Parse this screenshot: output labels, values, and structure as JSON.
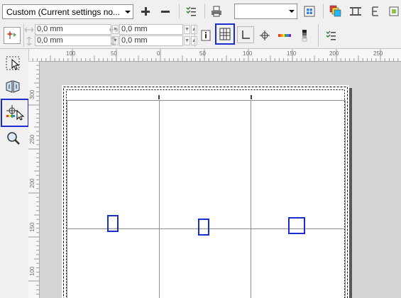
{
  "toolbar": {
    "preset": {
      "value": "Custom (Current settings no..."
    },
    "add_icon": "plus-icon",
    "remove_icon": "minus-icon",
    "zoom_value": ""
  },
  "property_bar": {
    "offset_x_top": "0,0 mm",
    "offset_y_top": "0,0 mm",
    "offset_x_bottom": "0,0 mm",
    "offset_y_bottom": "0,0 mm"
  },
  "hruler": {
    "labels": [
      "100",
      "50",
      "0",
      "50",
      "100",
      "150",
      "200",
      "250"
    ]
  },
  "vruler": {
    "labels": [
      "300",
      "250",
      "200",
      "150",
      "100"
    ]
  },
  "colors": {
    "accent": "#1a2ecf",
    "toolbar_bg": "#f0f0f0",
    "canvas_bg": "#d4d4d4"
  }
}
